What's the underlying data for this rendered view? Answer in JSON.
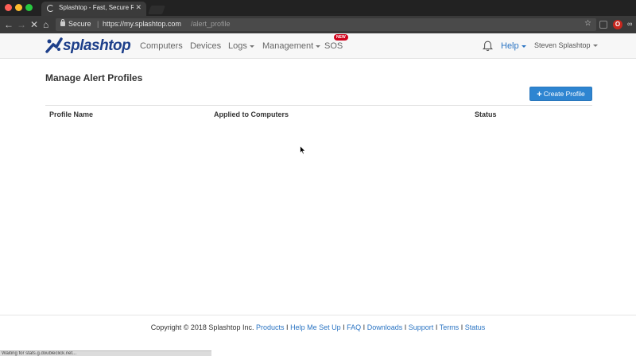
{
  "browser": {
    "tab_title": "Splashtop - Fast, Secure Rem",
    "secure_label": "Secure",
    "url_base": "https://my.splashtop.com",
    "url_path": "/alert_profile",
    "status_text": "Waiting for stats.g.doubleclick.net..."
  },
  "navbar": {
    "logo_text": "splashtop",
    "items": [
      "Computers",
      "Devices",
      "Logs",
      "Management",
      "SOS"
    ],
    "sos_badge": "NEW",
    "help_label": "Help",
    "user_label": "Steven Splashtop"
  },
  "main": {
    "title": "Manage Alert Profiles",
    "create_button": "Create Profile",
    "columns": [
      "Profile Name",
      "Applied to Computers",
      "Status"
    ]
  },
  "footer": {
    "copyright": "Copyright © 2018 Splashtop Inc.",
    "links": [
      "Products",
      "Help Me Set Up",
      "FAQ",
      "Downloads",
      "Support",
      "Terms",
      "Status"
    ],
    "separator": "I"
  },
  "colors": {
    "brand_blue": "#1d3f8a",
    "link_blue": "#2a74c3",
    "button_blue": "#2e85d1",
    "badge_red": "#d0021b"
  },
  "icons": [
    "search-icon",
    "bell-icon",
    "plus-icon",
    "star-icon",
    "lock-icon",
    "reload-icon"
  ]
}
